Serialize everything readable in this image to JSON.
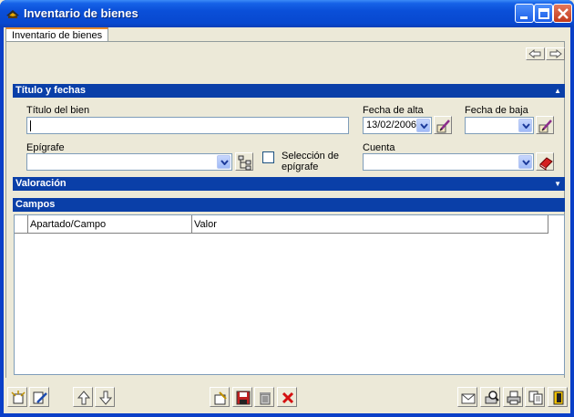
{
  "window": {
    "title": "Inventario de bienes",
    "icon": "app-hat-icon",
    "controls": [
      "minimize-icon",
      "maximize-icon",
      "close-icon"
    ]
  },
  "tabs": [
    {
      "label": "Inventario de bienes",
      "active": true
    }
  ],
  "nav": {
    "prev_icon": "arrow-left-icon",
    "next_icon": "arrow-right-icon"
  },
  "sections": {
    "titulo": {
      "label": "Título y fechas",
      "expanded": true
    },
    "valoracion": {
      "label": "Valoración",
      "expanded": false
    },
    "campos": {
      "label": "Campos"
    }
  },
  "form": {
    "titulo_label": "Título del bien",
    "titulo_value": "",
    "fecha_alta_label": "Fecha de alta",
    "fecha_alta_value": "13/02/2006",
    "fecha_baja_label": "Fecha de baja",
    "fecha_baja_value": "",
    "epigrafe_label": "Epígrafe",
    "epigrafe_value": "",
    "seleccion_label_1": "Selección de",
    "seleccion_label_2": "epígrafe",
    "seleccion_checked": false,
    "cuenta_label": "Cuenta",
    "cuenta_value": ""
  },
  "grid": {
    "columns": [
      "Apartado/Campo",
      "Valor"
    ],
    "rows": []
  },
  "toolbar": {
    "left": [
      "new-record-icon",
      "edit-record-icon"
    ],
    "move": [
      "arrow-up-icon",
      "arrow-down-icon"
    ],
    "middle": [
      "attach-icon",
      "save-icon",
      "trash-icon",
      "delete-x-icon"
    ],
    "right": [
      "mail-icon",
      "print-preview-icon",
      "print-icon",
      "copy-icon",
      "exit-door-icon"
    ]
  },
  "colors": {
    "section_header": "#0a3fa8",
    "titlebar": "#0a4fd8",
    "face": "#ece9d8"
  }
}
